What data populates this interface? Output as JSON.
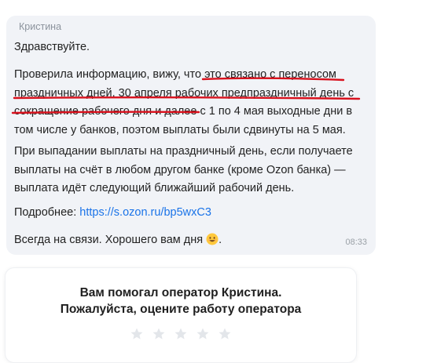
{
  "message": {
    "sender": "Кристина",
    "greeting": "Здравствуйте.",
    "paragraph1": {
      "l1a": "Проверила информацию, вижу, что ",
      "l1b": "это связано с переносом",
      "l2": "праздничных дней, 30 апреля рабочих предпраздничный день с",
      "l3a": "сокращение рабочего дня и далее",
      "l3b": " с 1 по 4 мая выходные дни в",
      "l4": "том числе у банков, поэтом выплаты были сдвинуты на 5 мая."
    },
    "paragraph2": [
      "При выпадании выплаты на праздничный день, если получаете",
      "выплаты на счёт в любом другом банке (кроме Ozon банка) —",
      "выплата идёт следующий ближайший рабочий день."
    ],
    "more_label": "Подробнее: ",
    "more_link": "https://s.ozon.ru/bp5wxC3",
    "closing": "Всегда на связи. Хорошего вам дня",
    "closing_end": ".",
    "time": "08:33"
  },
  "rating": {
    "title_line1": "Вам помогал оператор Кристина.",
    "title_line2": "Пожалуйста, оцените работу оператора",
    "stars": 5,
    "star_color": "#e3e6ea"
  },
  "annotation_color": "#d8101c",
  "emoji": "smiling-face-emoji"
}
